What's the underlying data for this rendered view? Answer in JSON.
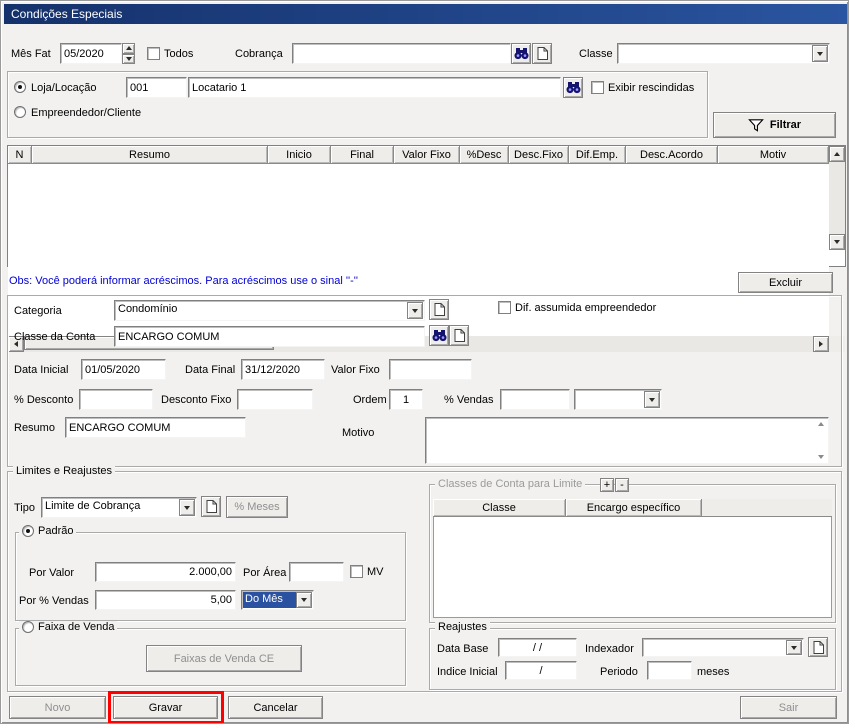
{
  "window": {
    "title": "Condições Especiais"
  },
  "colors": {
    "titlebar": "#15316b",
    "selection": "#2a52a0",
    "note_text": "#0000d4",
    "annotation": "#fe0000"
  },
  "icons": {
    "binoculars": "search-browse",
    "document_new": "blank-page-folded-corner",
    "filter_funnel": "funnel-outline",
    "dropdown_arrow": "▼",
    "spin_up": "▲",
    "spin_down": "▼",
    "scroll_left": "◄",
    "scroll_right": "►",
    "scroll_up": "▲",
    "scroll_down": "▼"
  },
  "topbar": {
    "mes_fat_label": "Mês Fat",
    "mes_fat_value": "05/2020",
    "todos_label": "Todos",
    "cobranca_label": "Cobrança",
    "cobranca_value": "",
    "classe_label": "Classe",
    "classe_value": ""
  },
  "filter_box": {
    "loja_label": "Loja/Locação",
    "loja_code": "001",
    "loja_name": "Locatario 1",
    "exibir_label": "Exibir rescindidas",
    "empreendedor_label": "Empreendedor/Cliente",
    "filtrar_label": "Filtrar"
  },
  "grid": {
    "columns": [
      "N",
      "Resumo",
      "Inicio",
      "Final",
      "Valor Fixo",
      "%Desc",
      "Desc.Fixo",
      "Dif.Emp.",
      "Desc.Acordo",
      "Motiv"
    ]
  },
  "note_text": "Obs: Você poderá informar acréscimos. Para acréscimos use o sinal ''-''",
  "excluir_label": "Excluir",
  "detail": {
    "categoria_label": "Categoria",
    "categoria_value": "Condomínio",
    "dif_label": "Dif. assumida empreendedor",
    "classe_conta_label": "Classe da Conta",
    "classe_conta_value": "ENCARGO COMUM",
    "data_inicial_label": "Data Inicial",
    "data_inicial_value": "01/05/2020",
    "data_final_label": "Data Final",
    "data_final_value": "31/12/2020",
    "valor_fixo_label": "Valor Fixo",
    "valor_fixo_value": "",
    "perc_desconto_label": "% Desconto",
    "perc_desconto_value": "",
    "desconto_fixo_label": "Desconto Fixo",
    "desconto_fixo_value": "",
    "ordem_label": "Ordem",
    "ordem_value": "1",
    "perc_vendas_label": "% Vendas",
    "perc_vendas_value": "",
    "perc_vendas_period_value": "",
    "resumo_label": "Resumo",
    "resumo_value": "ENCARGO COMUM",
    "motivo_label": "Motivo",
    "motivo_value": ""
  },
  "limites": {
    "title": "Limites e Reajustes",
    "tipo_label": "Tipo",
    "tipo_value": "Limite de Cobrança",
    "perc_meses_label": "% Meses",
    "padrao": {
      "title": "Padrão",
      "por_valor_label": "Por Valor",
      "por_valor_value": "2.000,00",
      "por_area_label": "Por Área",
      "por_area_value": "",
      "mv_label": "MV",
      "por_perc_vendas_label": "Por % Vendas",
      "por_perc_vendas_value": "5,00",
      "periodo_value": "Do Mês"
    },
    "faixa": {
      "title": "Faixa de Venda",
      "button_label": "Faixas de Venda CE"
    }
  },
  "classes_limite": {
    "title": "Classes de Conta para Limite",
    "plus_label": "+",
    "minus_label": "-",
    "columns": [
      "Classe",
      "Encargo específico"
    ]
  },
  "reajustes": {
    "title": "Reajustes",
    "data_base_label": "Data Base",
    "data_base_value": "/ /",
    "indexador_label": "Indexador",
    "indexador_value": "",
    "indice_label": "Indice Inicial",
    "indice_value": "/",
    "periodo_label": "Periodo",
    "periodo_value": "",
    "meses_label": "meses"
  },
  "footer": {
    "novo_label": "Novo",
    "gravar_label": "Gravar",
    "cancelar_label": "Cancelar",
    "sair_label": "Sair"
  }
}
